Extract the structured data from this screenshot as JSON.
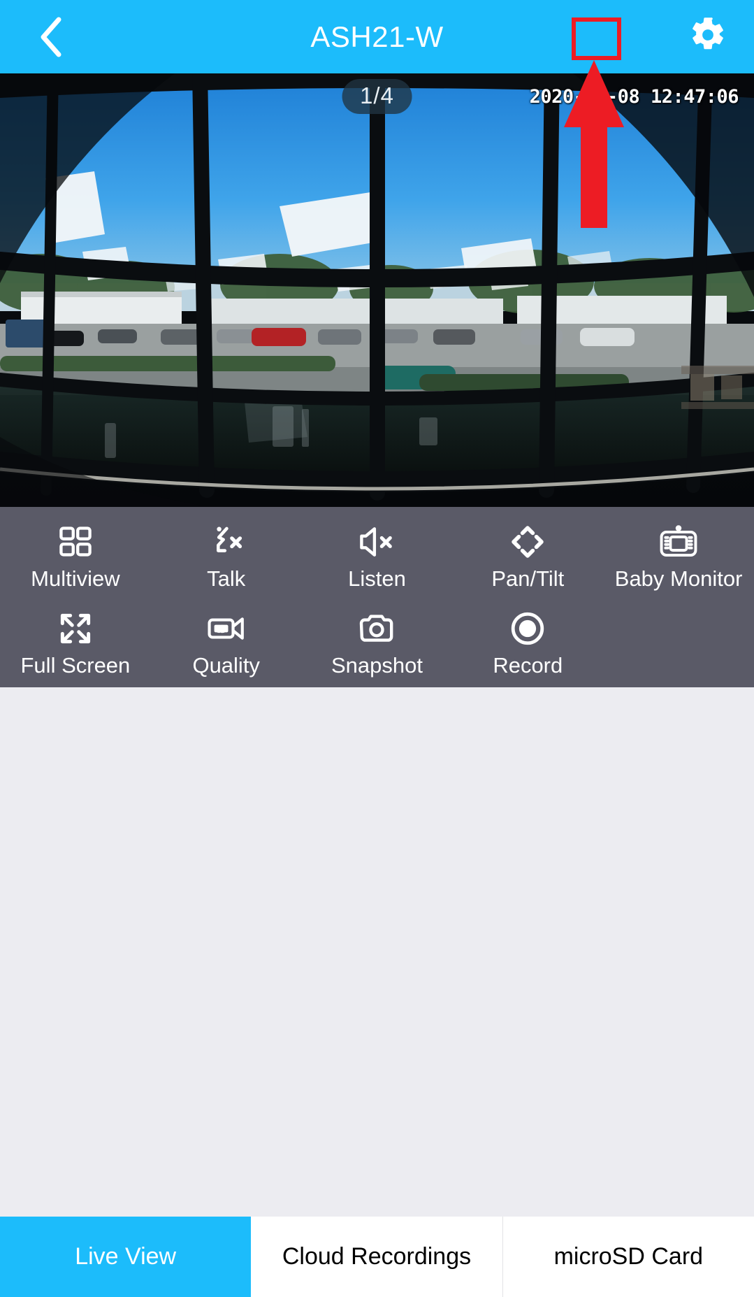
{
  "header": {
    "title": "ASH21-W",
    "back_icon": "chevron-left-icon",
    "settings_icon": "gear-icon"
  },
  "annotation": {
    "highlight_color": "#ED1C24",
    "arrow_color": "#ED1C24",
    "target": "gear-icon"
  },
  "video": {
    "count_badge": "1/4",
    "timestamp": "2020-01-08 12:47:06",
    "description": "Live camera view through large storefront windows onto a parking lot"
  },
  "controls": {
    "row1": [
      {
        "label": "Multiview",
        "icon": "grid-four-icon"
      },
      {
        "label": "Talk",
        "icon": "talk-muted-icon"
      },
      {
        "label": "Listen",
        "icon": "speaker-muted-icon"
      },
      {
        "label": "Pan/Tilt",
        "icon": "pan-tilt-icon"
      },
      {
        "label": "Baby Monitor",
        "icon": "baby-monitor-icon"
      }
    ],
    "row2": [
      {
        "label": "Full Screen",
        "icon": "expand-icon"
      },
      {
        "label": "Quality",
        "icon": "sd-camera-icon"
      },
      {
        "label": "Snapshot",
        "icon": "camera-icon"
      },
      {
        "label": "Record",
        "icon": "record-circle-icon"
      }
    ]
  },
  "tabs": [
    {
      "label": "Live View",
      "active": true
    },
    {
      "label": "Cloud Recordings",
      "active": false
    },
    {
      "label": "microSD Card",
      "active": false
    }
  ],
  "colors": {
    "accent": "#1CBCFB",
    "panel": "#5A5A67",
    "page_bg": "#ECECF1",
    "annotation_red": "#ED1C24"
  }
}
